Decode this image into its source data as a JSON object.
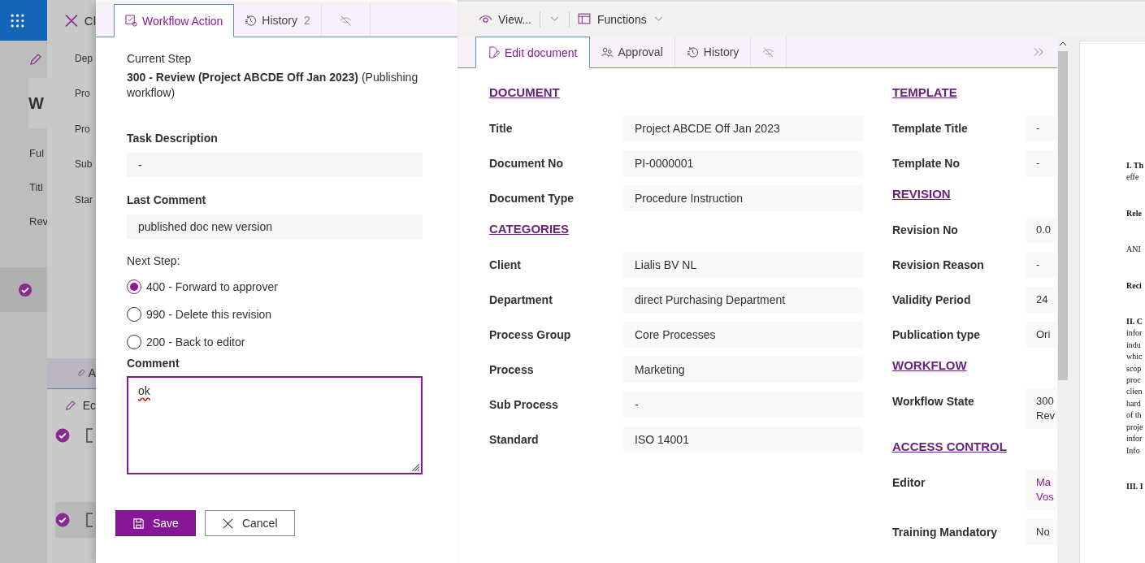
{
  "background": {
    "list": {
      "heading": "W",
      "fields": [
        "Ful",
        "Titl",
        "Rev"
      ],
      "row_checked": true
    },
    "details": {
      "close_label": "Cl",
      "fields": [
        "Dep",
        "Pro",
        "Pro",
        "Sub",
        "Star"
      ],
      "attachments_tab": "A",
      "edit_label": "Ec",
      "rows": [
        {
          "checked": true
        },
        {
          "checked": true
        }
      ]
    }
  },
  "workflow_panel": {
    "tabs": [
      {
        "kind": "action",
        "label": "Workflow Action",
        "selected": true
      },
      {
        "kind": "history",
        "label": "History",
        "count": "2",
        "selected": false
      },
      {
        "kind": "hide",
        "selected": false
      }
    ],
    "current_step_label": "Current Step",
    "current_step": "**300 - Review (Project ABCDE Off Jan 2023)** (Publishing workflow)",
    "task_description_label": "Task Description",
    "task_description": "-",
    "last_comment_label": "Last Comment",
    "last_comment": "published doc new version",
    "next_step_label": "Next Step:",
    "options": [
      {
        "label": "400 - Forward to approver",
        "selected": true
      },
      {
        "label": "990 - Delete this revision",
        "selected": false
      },
      {
        "label": "200 - Back to editor",
        "selected": false
      }
    ],
    "comment_label": "Comment",
    "comment": "ok",
    "save": "Save",
    "cancel": "Cancel"
  },
  "toolbar": {
    "view": "View...",
    "functions": "Functions"
  },
  "document_tabs": [
    {
      "kind": "edit",
      "label": "Edit document",
      "selected": true
    },
    {
      "kind": "approval",
      "label": "Approval",
      "selected": false
    },
    {
      "kind": "history",
      "label": "History",
      "selected": false
    },
    {
      "kind": "hide",
      "selected": false
    }
  ],
  "form": {
    "left": [
      {
        "heading": "DOCUMENT",
        "fields": [
          {
            "label": "Title",
            "value": "Project ABCDE Off Jan 2023"
          },
          {
            "label": "Document No",
            "value": "PI-0000001"
          },
          {
            "label": "Document Type",
            "value": "Procedure Instruction"
          }
        ]
      },
      {
        "heading": "CATEGORIES",
        "fields": [
          {
            "label": "Client",
            "value": "Lialis BV NL"
          },
          {
            "label": "Department",
            "value": "direct Purchasing Department"
          },
          {
            "label": "Process Group",
            "value": "Core Processes"
          },
          {
            "label": "Process",
            "value": "Marketing"
          },
          {
            "label": "Sub Process",
            "value": "-"
          },
          {
            "label": "Standard",
            "value": "ISO 14001"
          }
        ]
      }
    ],
    "right": [
      {
        "heading": "TEMPLATE",
        "fields": [
          {
            "label": "Template Title",
            "value": "-"
          },
          {
            "label": "Template No",
            "value": "-"
          }
        ]
      },
      {
        "heading": "REVISION",
        "fields": [
          {
            "label": "Revision No",
            "value": "0.0"
          },
          {
            "label": "Revision Reason",
            "value": "-"
          },
          {
            "label": "Validity Period",
            "value": "24"
          },
          {
            "label": "Publication type",
            "value": "Ori"
          }
        ]
      },
      {
        "heading": "WORKFLOW",
        "fields": [
          {
            "label": "Workflow State",
            "value": "300 Rev"
          }
        ]
      },
      {
        "heading": "ACCESS CONTROL",
        "fields": [
          {
            "label": "Editor",
            "value": "Ma Vos",
            "link": true
          },
          {
            "label": "Training Mandatory",
            "value": "No"
          }
        ]
      }
    ]
  },
  "preview": {
    "paragraphs": [
      [
        {
          "text": "I. Th",
          "bold": true
        },
        {
          "text": "effe",
          "bold": false
        }
      ],
      [
        {
          "text": "Rele",
          "bold": true
        }
      ],
      [
        {
          "text": "ANI",
          "bold": false
        }
      ],
      [
        {
          "text": "Reci",
          "bold": true
        }
      ],
      [
        {
          "text": "II. C",
          "bold": true
        },
        {
          "text": "infor",
          "bold": false
        },
        {
          "text": "indu",
          "bold": false
        },
        {
          "text": "whic",
          "bold": false
        },
        {
          "text": "scop",
          "bold": false
        },
        {
          "text": "proc",
          "bold": false
        },
        {
          "text": "clien",
          "bold": false
        },
        {
          "text": "hard",
          "bold": false
        },
        {
          "text": "of th",
          "bold": false
        },
        {
          "text": "proje",
          "bold": false
        },
        {
          "text": "infor",
          "bold": false
        },
        {
          "text": "Info",
          "bold": false
        }
      ],
      [
        {
          "text": "III. I",
          "bold": true
        }
      ]
    ]
  }
}
